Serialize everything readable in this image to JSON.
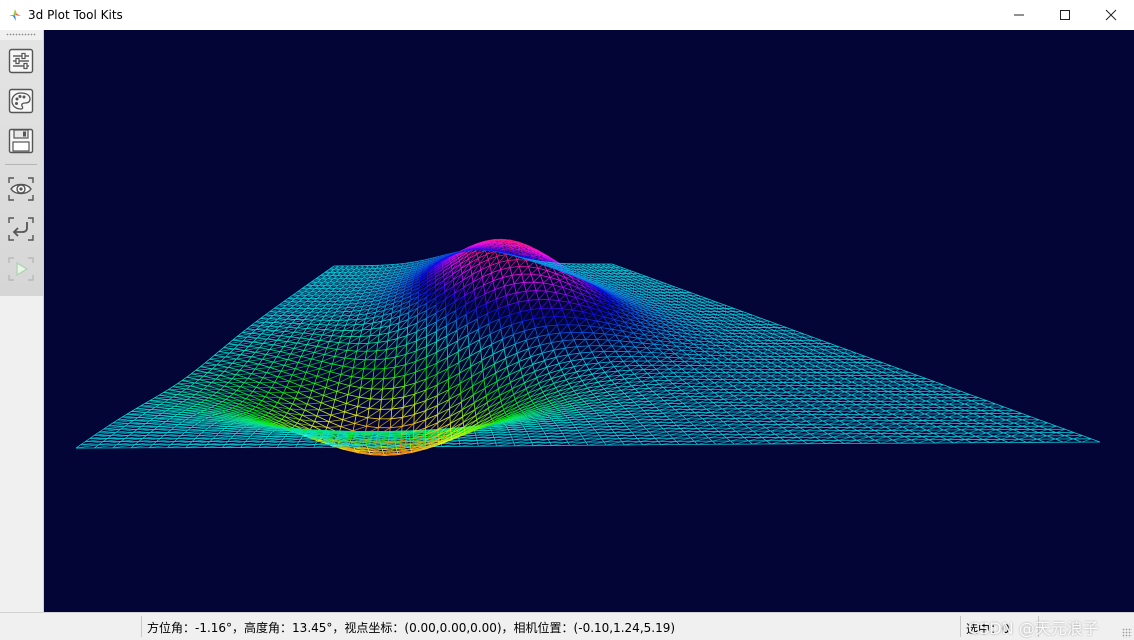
{
  "window": {
    "title": "3d Plot Tool Kits",
    "icon": "colorful-spark-icon",
    "controls": [
      "minimize-icon",
      "maximize-icon",
      "close-icon"
    ]
  },
  "toolbar": {
    "buttons": [
      {
        "name": "settings-sliders-button",
        "icon": "sliders-icon",
        "enabled": true
      },
      {
        "name": "color-palette-button",
        "icon": "palette-icon",
        "enabled": true
      },
      {
        "name": "save-button",
        "icon": "floppy-disk-icon",
        "enabled": true
      },
      {
        "name": "view-button",
        "icon": "eye-icon",
        "enabled": true
      },
      {
        "name": "reset-view-button",
        "icon": "return-arrow-icon",
        "enabled": true
      },
      {
        "name": "play-button",
        "icon": "play-icon",
        "enabled": false
      }
    ]
  },
  "plot": {
    "background": "#020535",
    "surface": "wireframe z = x*exp(-(x^2+y^2)) style dipole",
    "colormap": "hsv rainbow"
  },
  "status": {
    "camera_info": "方位角：-1.16°，高度角：13.45°，视点坐标：(0.00,0.00,0.00)，相机位置：(-0.10,1.24,5.19)",
    "selected": "选中：0"
  },
  "watermark": "CSDN @天元浪子"
}
